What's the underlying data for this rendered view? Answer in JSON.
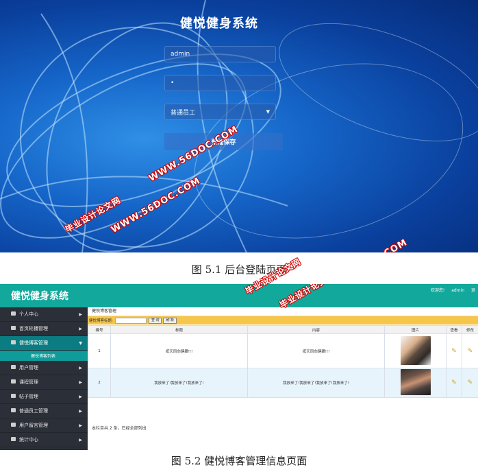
{
  "login": {
    "title": "健悦健身系统",
    "username_value": "admin",
    "password_value": "•",
    "role_value": "普通员工",
    "login_button": "登陆保存"
  },
  "captions": {
    "fig1": "图 5.1 后台登陆页面",
    "fig2": "图 5.2 健悦博客管理信息页面"
  },
  "admin": {
    "brand": "健悦健身系统",
    "welcome": "欢迎您!",
    "user": "admin",
    "logout": "退",
    "sidebar": [
      {
        "label": "个人中心"
      },
      {
        "label": "首页轮播管理"
      },
      {
        "label": "健悦博客管理"
      },
      {
        "label": "用户管理"
      },
      {
        "label": "课程管理"
      },
      {
        "label": "帖子管理"
      },
      {
        "label": "普通员工管理"
      },
      {
        "label": "用户留言管理"
      },
      {
        "label": "统计中心"
      }
    ],
    "sidebar_sub": "健悦博客列表",
    "breadcrumb": "健悦博客管理",
    "search": {
      "label": "健悦博客标题:",
      "query_button": "查 询",
      "refresh_button": "刷 新"
    },
    "table": {
      "headers": [
        "编号",
        "标题",
        "内容",
        "图片",
        "查看",
        "修改"
      ],
      "rows": [
        {
          "id": "1",
          "title": "纸天同向健肆!!!",
          "content": "纸天同向健肆!!!"
        },
        {
          "id": "2",
          "title": "我放来了!我放来了!我放来了!",
          "content": "我放来了!我放来了!我放来了!我放来了!"
        }
      ]
    },
    "footer_note": "本栏目共 2 条，已经全部列出"
  },
  "watermarks": {
    "site": "WWW.56DOC.COM",
    "cn": "毕业设计论文网"
  },
  "colors": {
    "topbar": "#12a89c",
    "sidebar": "#2b2f38",
    "sidebar_active": "#0b7d82",
    "search_bar": "#f6c64a",
    "login_bg": "#1565c8"
  }
}
